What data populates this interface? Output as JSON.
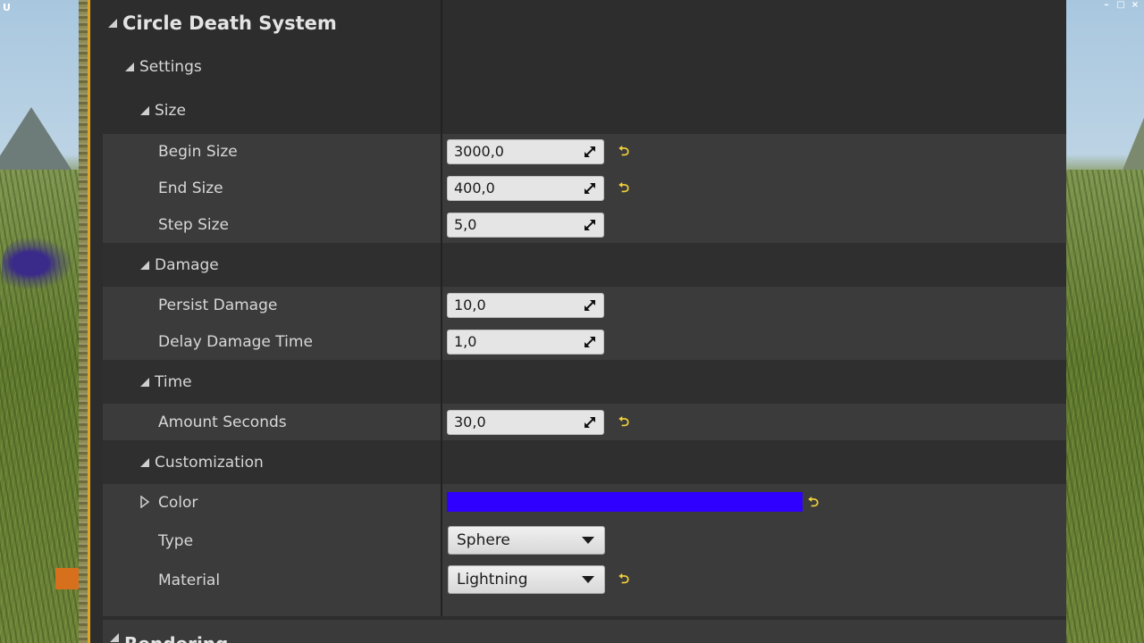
{
  "window": {
    "app_icon": "U",
    "controls": [
      "–",
      "□",
      "×"
    ]
  },
  "panel": {
    "title": "Circle Death System",
    "settings_label": "Settings",
    "groups": {
      "size": {
        "label": "Size",
        "begin_size": {
          "label": "Begin Size",
          "value": "3000,0"
        },
        "end_size": {
          "label": "End Size",
          "value": "400,0"
        },
        "step_size": {
          "label": "Step Size",
          "value": "5,0"
        }
      },
      "damage": {
        "label": "Damage",
        "persist_damage": {
          "label": "Persist Damage",
          "value": "10,0"
        },
        "delay_damage_time": {
          "label": "Delay Damage Time",
          "value": "1,0"
        }
      },
      "time": {
        "label": "Time",
        "amount_seconds": {
          "label": "Amount Seconds",
          "value": "30,0"
        }
      },
      "customization": {
        "label": "Customization",
        "color": {
          "label": "Color",
          "swatch": "#2f00ff"
        },
        "type": {
          "label": "Type",
          "value": "Sphere"
        },
        "material": {
          "label": "Material",
          "value": "Lightning"
        }
      }
    },
    "next_category": "Rendering"
  },
  "icons": {
    "reset": "reset-to-default-icon",
    "drag": "drag-arrows-icon",
    "dropdown": "chevron-down-icon"
  },
  "colors": {
    "panel_bg": "#2d2d2d",
    "row_bg": "#3b3b3b",
    "reset_yellow": "#f2d23a",
    "accent_gold": "#e2a520"
  }
}
